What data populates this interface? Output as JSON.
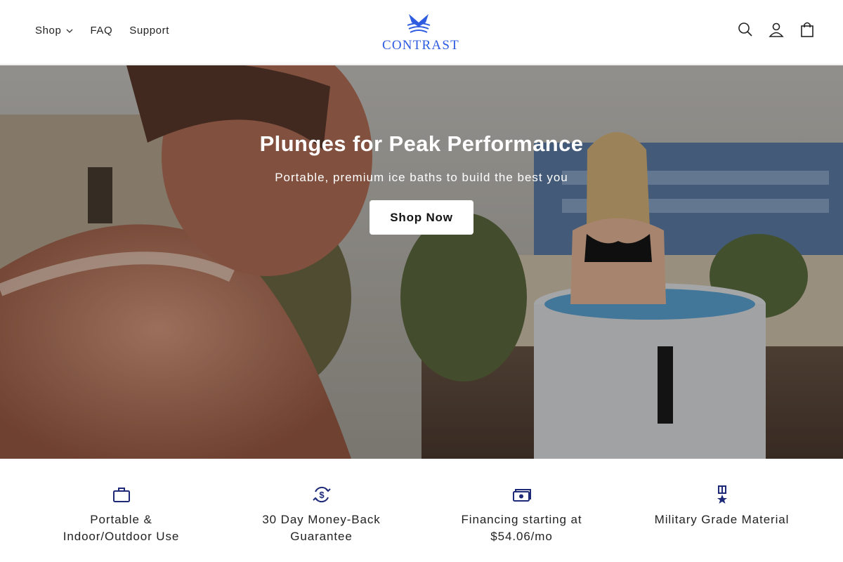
{
  "header": {
    "nav": [
      {
        "label": "Shop",
        "has_dropdown": true
      },
      {
        "label": "FAQ",
        "has_dropdown": false
      },
      {
        "label": "Support",
        "has_dropdown": false
      }
    ],
    "logo_text": "CONTRAST",
    "icons": [
      "search-icon",
      "account-icon",
      "cart-icon"
    ]
  },
  "hero": {
    "title": "Plunges for Peak Performance",
    "subtitle": "Portable, premium ice baths to build the best you",
    "cta_label": "Shop Now"
  },
  "features": [
    {
      "icon": "briefcase-icon",
      "text": "Portable & Indoor/Outdoor Use"
    },
    {
      "icon": "dollar-cycle-icon",
      "text": "30 Day Money-Back Guarantee"
    },
    {
      "icon": "money-icon",
      "text": "Financing starting at $54.06/mo"
    },
    {
      "icon": "medal-icon",
      "text": "Military Grade Material"
    }
  ],
  "colors": {
    "brand": "#2e5be0",
    "feature_icon": "#1e2a78"
  }
}
